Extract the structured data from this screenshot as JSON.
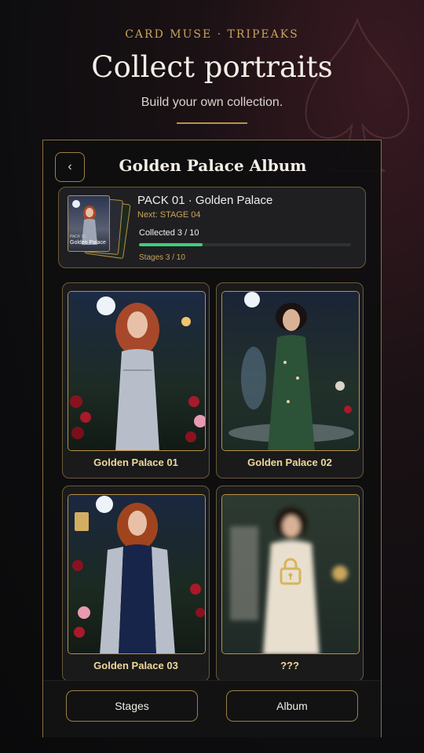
{
  "header": {
    "kicker": "CARD MUSE · TRIPEAKS",
    "title": "Collect portraits",
    "subtitle": "Build your own collection."
  },
  "panel": {
    "title": "Golden Palace Album",
    "back_icon": "chevron-left-icon"
  },
  "pack": {
    "name": "PACK 01 · Golden Palace",
    "next": "Next: STAGE 04",
    "collected": "Collected 3 / 10",
    "progress": 0.3,
    "stages": "Stages 3 / 10",
    "thumb_pack": "PACK 01",
    "thumb_title": "Golden Palace"
  },
  "cards": [
    {
      "label": "Golden Palace 01",
      "locked": false
    },
    {
      "label": "Golden Palace 02",
      "locked": false
    },
    {
      "label": "Golden Palace 03",
      "locked": false
    },
    {
      "label": "???",
      "locked": true
    }
  ],
  "footer": {
    "stages_label": "Stages",
    "album_label": "Album"
  },
  "colors": {
    "gold": "#c9a45a",
    "progress": "#3ecf7c",
    "card_label": "#eed89a"
  }
}
